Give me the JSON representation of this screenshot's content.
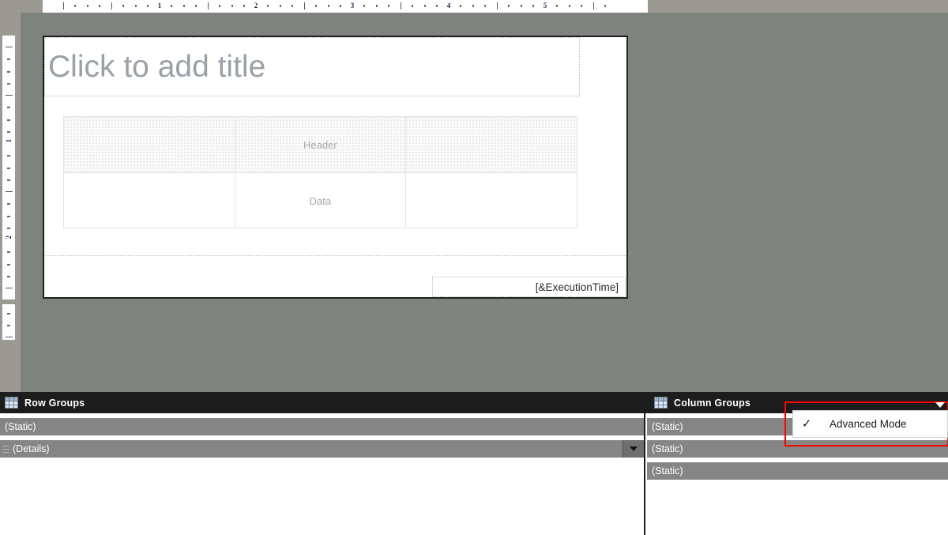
{
  "rulers": {
    "horizontal": {
      "name": "horizontal-ruler",
      "numbers": [
        "1",
        "2",
        "3",
        "4",
        "5"
      ],
      "unit": "inches"
    },
    "vertical": {
      "name": "vertical-ruler",
      "numbers": [
        "1",
        "2"
      ],
      "unit": "inches"
    }
  },
  "design_surface": {
    "title_placeholder": "Click to add title",
    "tablix": {
      "header_row": [
        "",
        "Header",
        ""
      ],
      "data_row": [
        "",
        "Data",
        ""
      ]
    },
    "footer": {
      "execution_time": "[&ExecutionTime]"
    }
  },
  "row_groups_panel": {
    "title": "Row Groups",
    "icon": "grid-icon",
    "rows": [
      {
        "label": "(Static)",
        "has_details_icon": false,
        "has_dropdown": false
      },
      {
        "label": "(Details)",
        "has_details_icon": true,
        "has_dropdown": true
      }
    ]
  },
  "column_groups_panel": {
    "title": "Column Groups",
    "icon": "grid-icon",
    "rows": [
      {
        "label": "(Static)"
      },
      {
        "label": "(Static)"
      },
      {
        "label": "(Static)"
      }
    ]
  },
  "context_menu": {
    "items": [
      {
        "label": "Advanced Mode",
        "checked": true,
        "check_glyph": "✓"
      }
    ]
  },
  "colors": {
    "canvas_background": "#7f837d",
    "ruler_background": "#9a9a93",
    "panel_header_background": "#1c1c1c",
    "group_row_background": "#858585",
    "highlight_border": "#ff0000",
    "title_placeholder_text": "#9aa1a8",
    "page_background": "#ffffff"
  }
}
